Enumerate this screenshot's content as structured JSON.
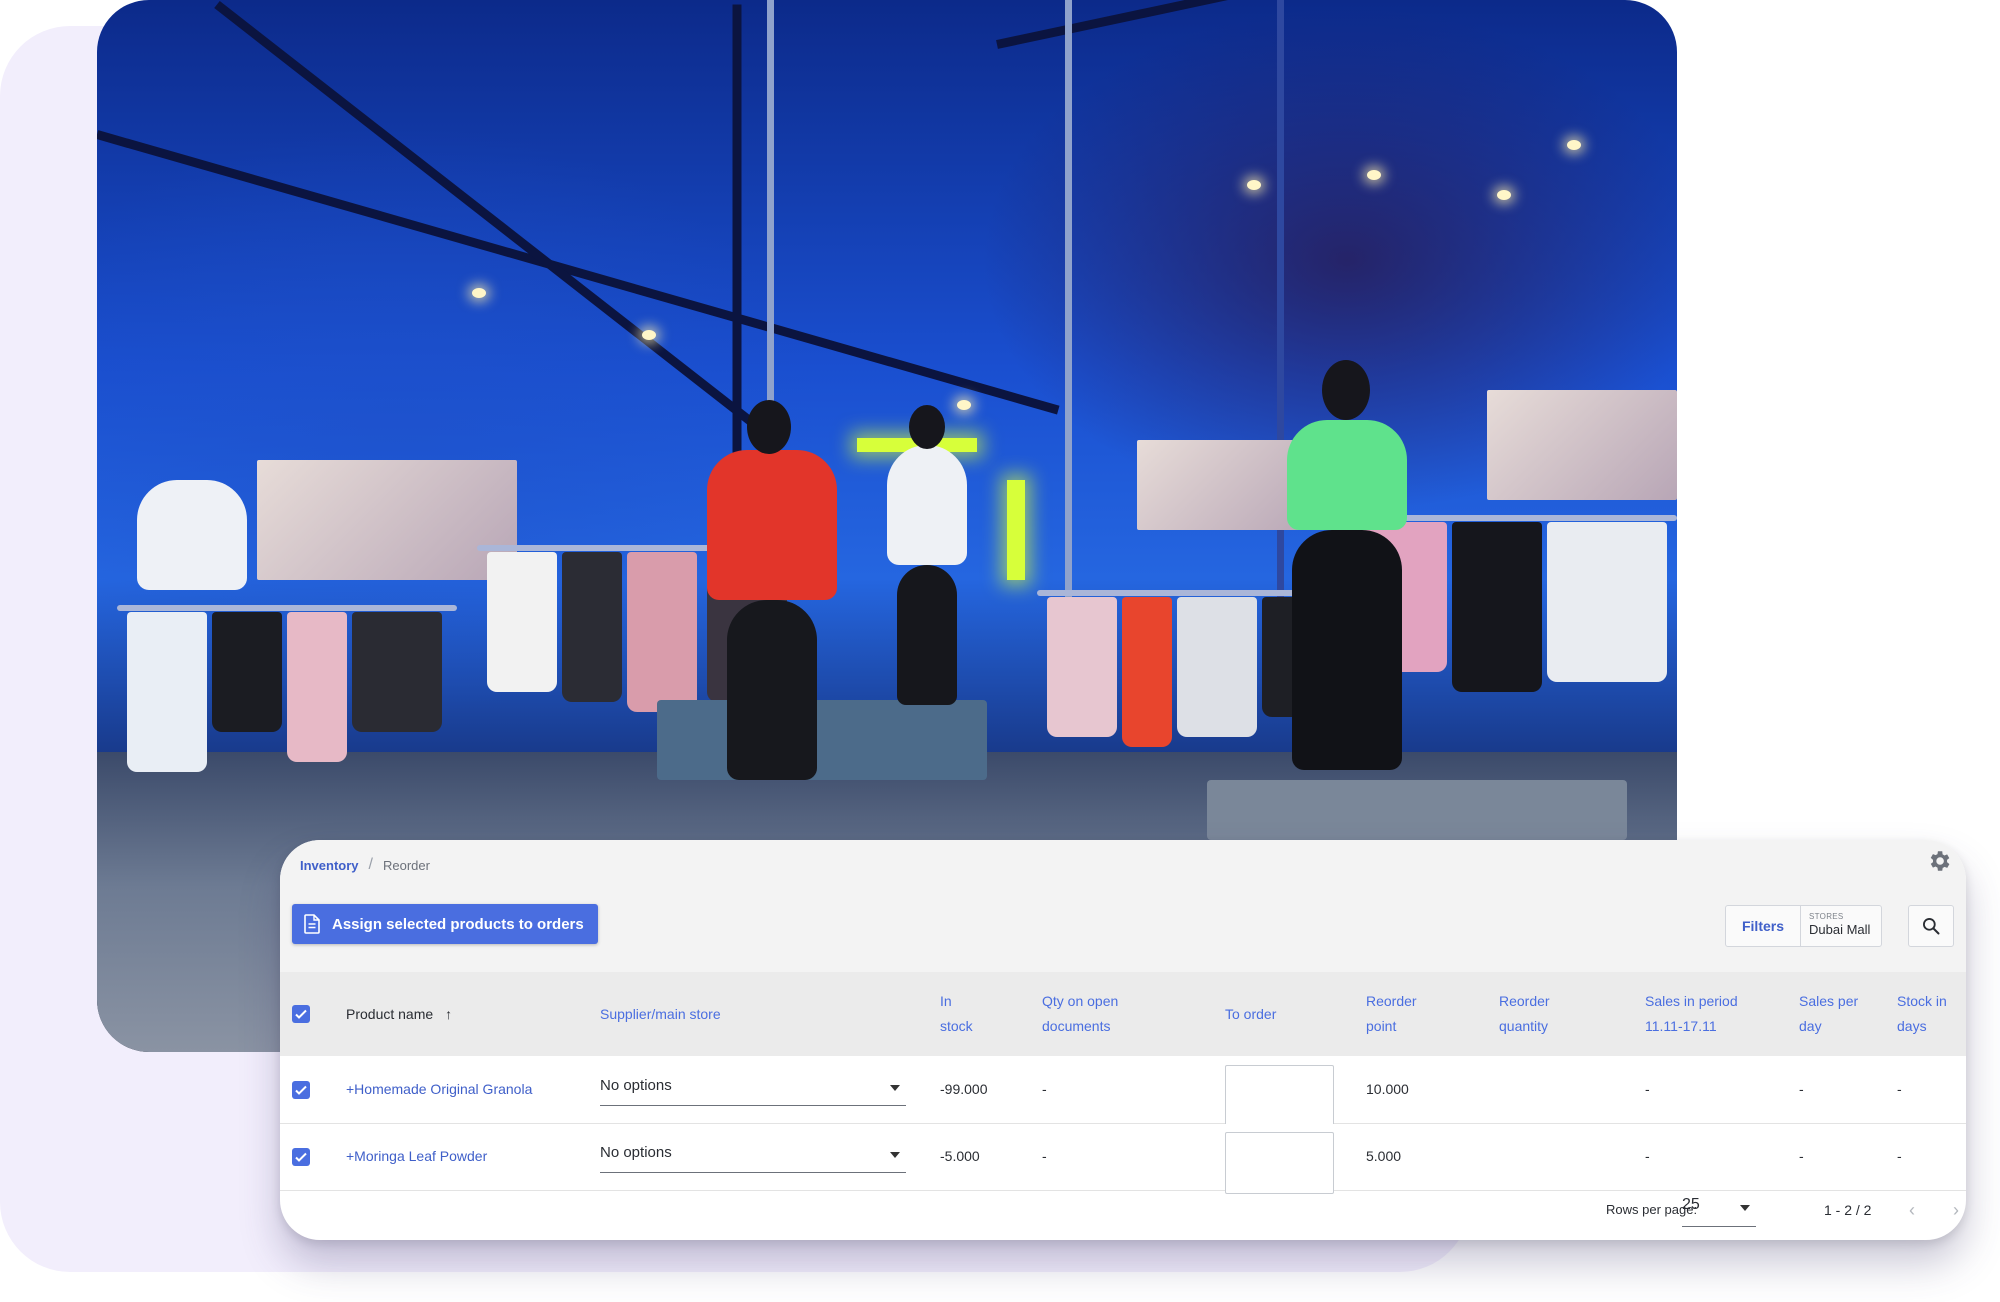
{
  "breadcrumb": {
    "parent": "Inventory",
    "separator": "/",
    "current": "Reorder"
  },
  "toolbar": {
    "assign_label": "Assign selected products to orders",
    "filters_label": "Filters",
    "store_label": "STORES",
    "store_value": "Dubai Mall"
  },
  "columns": {
    "product_name": "Product name",
    "supplier": "Supplier/main store",
    "in_stock": [
      "In",
      "stock"
    ],
    "qty_open": [
      "Qty on open",
      "documents"
    ],
    "to_order": "To order",
    "reorder_point": [
      "Reorder",
      "point"
    ],
    "reorder_qty": [
      "Reorder",
      "quantity"
    ],
    "sales_period": [
      "Sales in period",
      "11.11-17.11"
    ],
    "sales_per_day": [
      "Sales per",
      "day"
    ],
    "stock_days": [
      "Stock in",
      "days"
    ]
  },
  "rows": [
    {
      "product": "+Homemade Original Granola",
      "supplier": "No options",
      "in_stock": "-99.000",
      "qty_open": "-",
      "reorder_point": "10.000",
      "sales_period": "-",
      "sales_per_day": "-",
      "stock_days": "-"
    },
    {
      "product": "+Moringa Leaf Powder",
      "supplier": "No options",
      "in_stock": "-5.000",
      "qty_open": "-",
      "reorder_point": "5.000",
      "sales_period": "-",
      "sales_per_day": "-",
      "stock_days": "-"
    }
  ],
  "pagination": {
    "rows_per_page_label": "Rows per page:",
    "rows_per_page": "25",
    "range": "1 - 2 / 2",
    "prev": "‹",
    "next": "›"
  },
  "colors": {
    "accent": "#4a6ee0",
    "link": "#3f5fc9",
    "background_shape": "#f2eefc"
  }
}
